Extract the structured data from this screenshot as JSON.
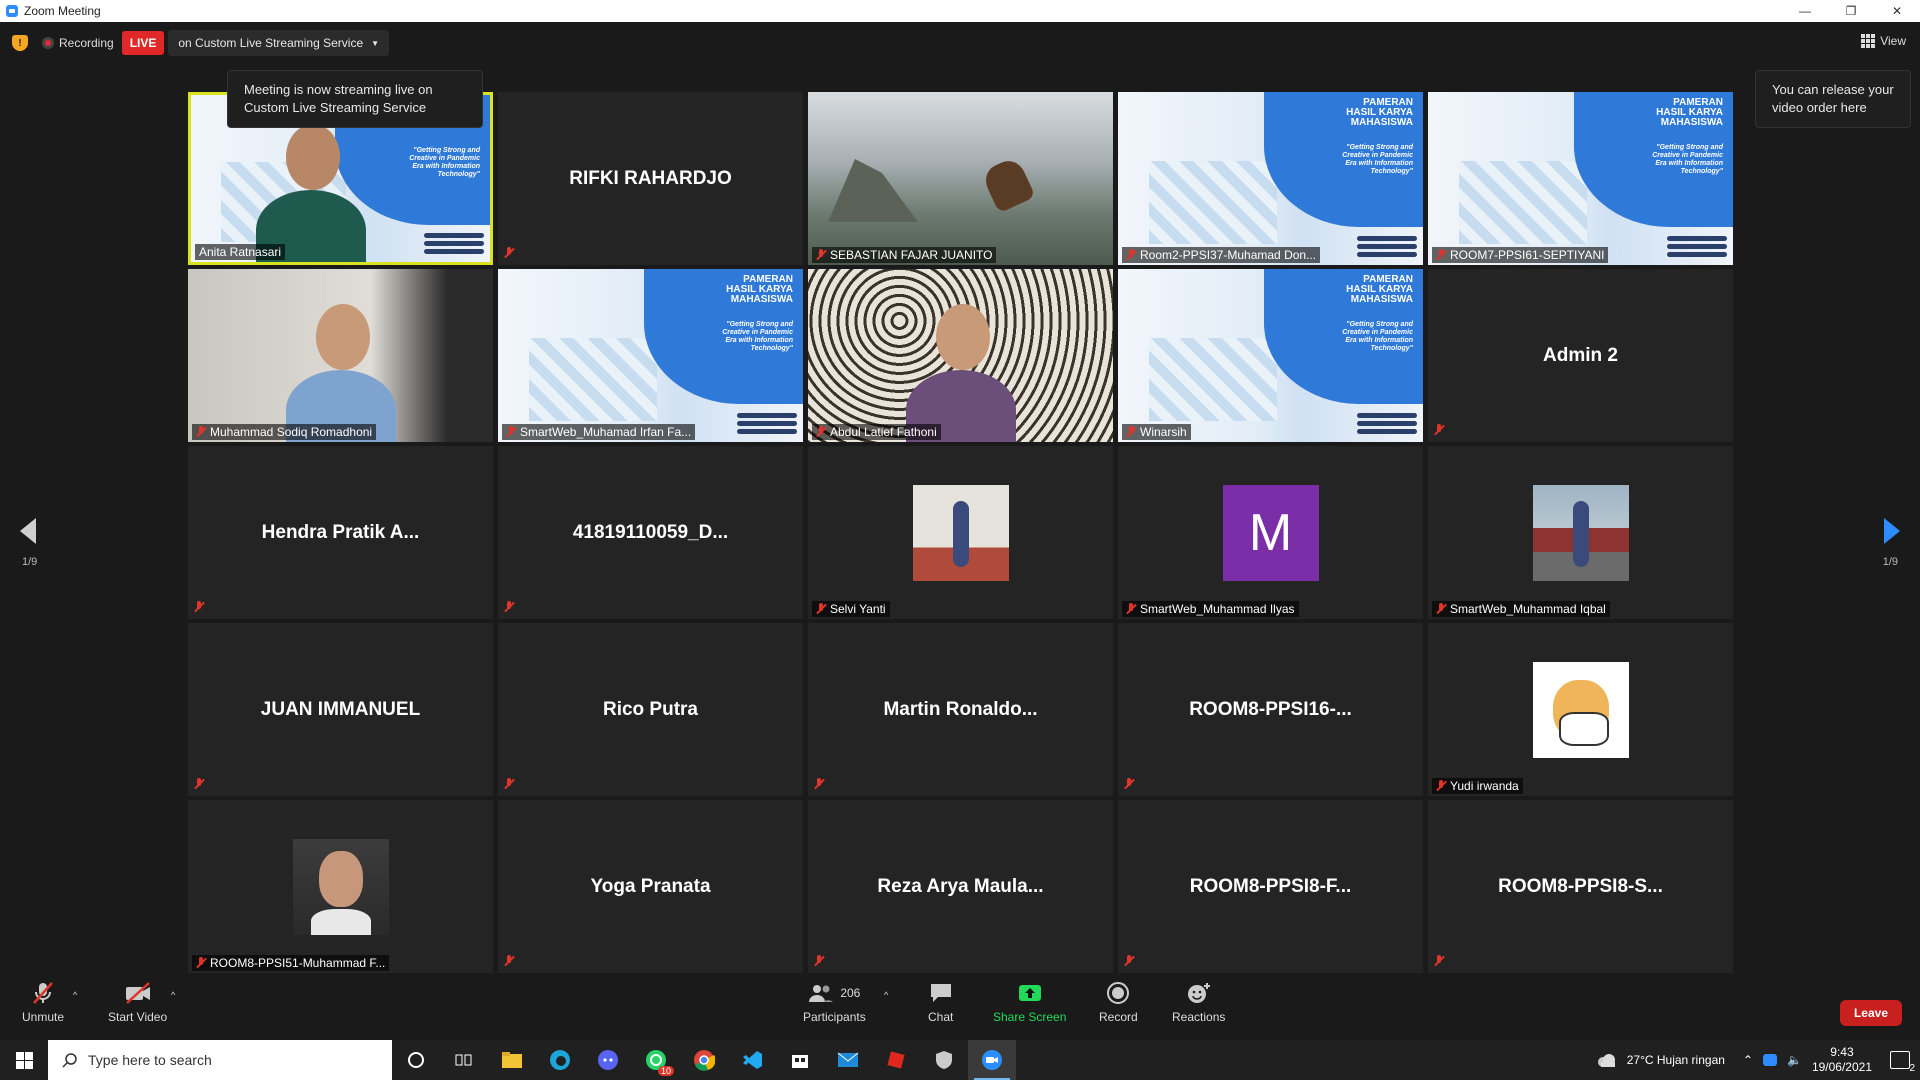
{
  "window": {
    "title": "Zoom Meeting"
  },
  "topbar": {
    "recording_label": "Recording",
    "live_label": "LIVE",
    "stream_service": "on Custom Live Streaming Service",
    "view_label": "View"
  },
  "tooltips": {
    "streaming": "Meeting is now streaming live on Custom Live Streaming Service",
    "video_order": "You can release your video order here"
  },
  "slide_text": "\"Getting Strong and Creative in Pandemic Era with Information Technology\"",
  "slide_title": "PAMERAN HASIL KARYA MAHASISWA",
  "pager": {
    "left": "1/9",
    "right": "1/9"
  },
  "participants": [
    {
      "name": "Anita Ratnasari",
      "kind": "video-slide-person",
      "active": true
    },
    {
      "name": "RIFKI RAHARDJO",
      "kind": "name"
    },
    {
      "name": "SEBASTIAN FAJAR JUANITO",
      "kind": "video-game"
    },
    {
      "name": "Room2-PPSI37-Muhamad Don...",
      "kind": "video-slide"
    },
    {
      "name": "ROOM7-PPSI61-SEPTIYANI",
      "kind": "video-slide"
    },
    {
      "name": "Muhammad Sodiq Romadhoni",
      "kind": "video-person"
    },
    {
      "name": "SmartWeb_Muhamad Irfan Fa...",
      "kind": "video-slide"
    },
    {
      "name": "Abdul Latief Fathoni",
      "kind": "video-person2"
    },
    {
      "name": "Winarsih",
      "kind": "video-slide"
    },
    {
      "name": "Admin 2",
      "kind": "name"
    },
    {
      "name": "Hendra Pratik A...",
      "kind": "name"
    },
    {
      "name": "41819110059_D...",
      "kind": "name"
    },
    {
      "name": "Selvi Yanti",
      "kind": "photo"
    },
    {
      "name": "SmartWeb_Muhammad Ilyas",
      "kind": "avatar",
      "initial": "M"
    },
    {
      "name": "SmartWeb_Muhammad Iqbal",
      "kind": "photo"
    },
    {
      "name": "JUAN IMMANUEL",
      "kind": "name"
    },
    {
      "name": "Rico Putra",
      "kind": "name"
    },
    {
      "name": "Martin  Ronaldo...",
      "kind": "name"
    },
    {
      "name": "ROOM8-PPSI16-...",
      "kind": "name"
    },
    {
      "name": "Yudi irwanda",
      "kind": "photo"
    },
    {
      "name": "ROOM8-PPSI51-Muhammad F...",
      "kind": "photo"
    },
    {
      "name": "Yoga Pranata",
      "kind": "name"
    },
    {
      "name": "Reza Arya Maula...",
      "kind": "name"
    },
    {
      "name": "ROOM8-PPSI8-F...",
      "kind": "name"
    },
    {
      "name": "ROOM8-PPSI8-S...",
      "kind": "name"
    }
  ],
  "toolbar": {
    "unmute": "Unmute",
    "start_video": "Start Video",
    "participants_count": "206",
    "participants": "Participants",
    "chat": "Chat",
    "share_screen": "Share Screen",
    "record": "Record",
    "reactions": "Reactions",
    "leave": "Leave"
  },
  "taskbar": {
    "search_placeholder": "Type here to search",
    "whatsapp_badge": "10",
    "weather": "27°C  Hujan ringan",
    "time": "9:43",
    "date": "19/06/2021",
    "notifications": "2"
  },
  "colors": {
    "active_speaker": "#d9e21f",
    "live": "#e02828",
    "share_screen": "#23d959",
    "leave": "#c8201f"
  }
}
